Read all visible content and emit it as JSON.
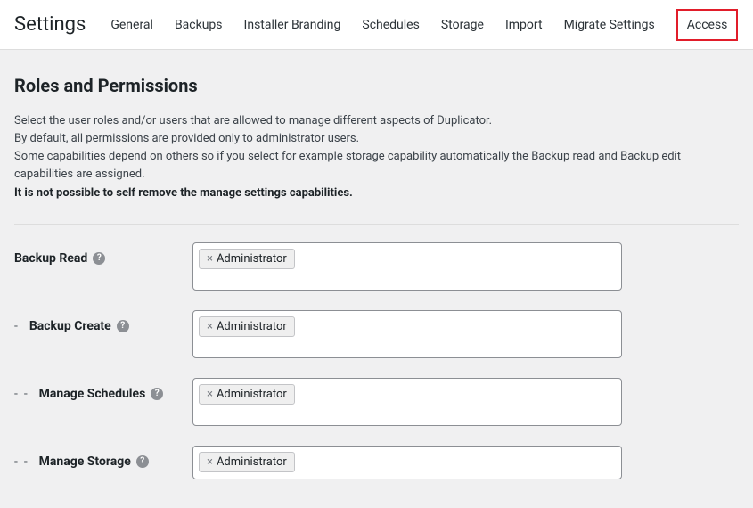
{
  "header": {
    "title": "Settings",
    "tabs": [
      {
        "label": "General"
      },
      {
        "label": "Backups"
      },
      {
        "label": "Installer Branding"
      },
      {
        "label": "Schedules"
      },
      {
        "label": "Storage"
      },
      {
        "label": "Import"
      },
      {
        "label": "Migrate Settings"
      },
      {
        "label": "Access",
        "active": true
      }
    ]
  },
  "section": {
    "heading": "Roles and Permissions",
    "para1": "Select the user roles and/or users that are allowed to manage different aspects of Duplicator.",
    "para2": "By default, all permissions are provided only to administrator users.",
    "para3": "Some capabilities depend on others so if you select for example storage capability automatically the Backup read and Backup edit capabilities are assigned.",
    "para4": "It is not possible to self remove the manage settings capabilities."
  },
  "rows": [
    {
      "indent": 0,
      "label": "Backup Read",
      "tag": "Administrator",
      "box": "tall"
    },
    {
      "indent": 1,
      "label": "Backup Create",
      "tag": "Administrator",
      "box": "tall"
    },
    {
      "indent": 2,
      "label": "Manage Schedules",
      "tag": "Administrator",
      "box": "tall"
    },
    {
      "indent": 2,
      "label": "Manage Storage",
      "tag": "Administrator",
      "box": "short"
    }
  ]
}
